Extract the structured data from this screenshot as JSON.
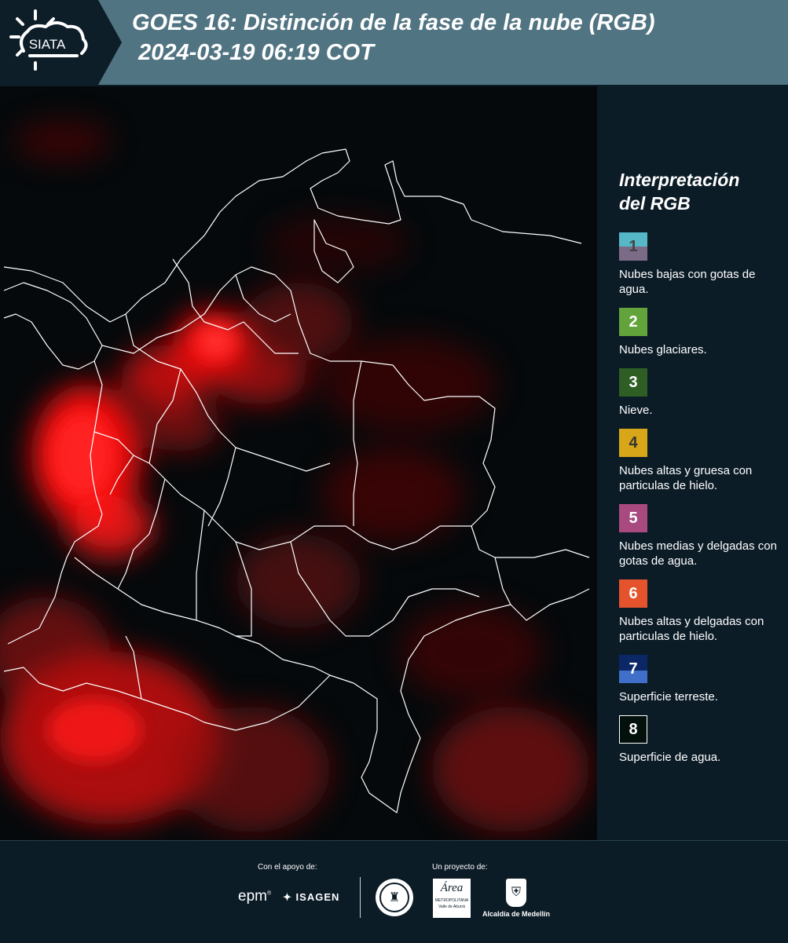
{
  "header": {
    "logo_text": "SIATA",
    "title_line1": "GOES 16: Distinción de la fase de la nube (RGB)",
    "title_line2": "2024-03-19 06:19 COT"
  },
  "legend": {
    "title_line1": "Interpretación",
    "title_line2": "del RGB",
    "items": [
      {
        "num": "1",
        "label": "Nubes bajas con gotas de agua.",
        "colors": [
          "#56b7c6",
          "#7b6b86"
        ]
      },
      {
        "num": "2",
        "label": "Nubes glaciares.",
        "colors": [
          "#62a33b"
        ]
      },
      {
        "num": "3",
        "label": "Nieve.",
        "colors": [
          "#2f5e25"
        ]
      },
      {
        "num": "4",
        "label": "Nubes altas y gruesa con particulas de hielo.",
        "colors": [
          "#d8a719"
        ]
      },
      {
        "num": "5",
        "label": "Nubes medias y delgadas con gotas de agua.",
        "colors": [
          "#a84a7f"
        ]
      },
      {
        "num": "6",
        "label": "Nubes altas y delgadas con particulas de hielo.",
        "colors": [
          "#e5532c"
        ]
      },
      {
        "num": "7",
        "label": "Superficie terreste.",
        "colors": [
          "#0c2766",
          "#3f6fc8"
        ]
      },
      {
        "num": "8",
        "label": "Superficie de agua.",
        "colors": [
          "#03100c"
        ]
      }
    ]
  },
  "footer": {
    "support_label": "Con el apoyo de:",
    "project_label": "Un proyecto de:",
    "epm": "epm",
    "isagen": "ISAGEN",
    "metro_name": "Área",
    "metro_sub": "METROPOLITANA",
    "metro_sub2": "Valle de Aburrá",
    "alcaldia": "Alcaldía de Medellín"
  },
  "colors": {
    "header_bg": "#517482",
    "panel_bg": "#0c1c27",
    "cloud_red": "#ff1a1a"
  }
}
